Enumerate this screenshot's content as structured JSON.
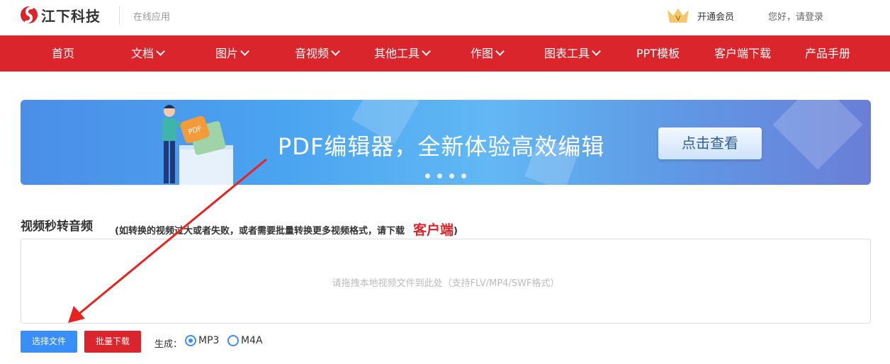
{
  "header": {
    "brand": "江下科技",
    "tagline": "在线应用",
    "vip_label": "开通会员",
    "login_label": "您好，请登录"
  },
  "nav": {
    "items": [
      {
        "label": "首页",
        "dropdown": false
      },
      {
        "label": "文档",
        "dropdown": true
      },
      {
        "label": "图片",
        "dropdown": true
      },
      {
        "label": "音视频",
        "dropdown": true
      },
      {
        "label": "其他工具",
        "dropdown": true
      },
      {
        "label": "作图",
        "dropdown": true
      },
      {
        "label": "图表工具",
        "dropdown": true
      },
      {
        "label": "PPT模板",
        "dropdown": false
      },
      {
        "label": "客户端下载",
        "dropdown": false
      },
      {
        "label": "产品手册",
        "dropdown": false
      }
    ]
  },
  "banner": {
    "headline": "PDF编辑器，全新体验高效编辑",
    "button_label": "点击查看",
    "badge_text": "PDF",
    "slides": 4
  },
  "tool": {
    "title": "视频秒转音频",
    "note_prefix": "(如转换的视频过大或者失败，或者需要批量转换更多视频格式，请下载",
    "client_link": "客户端",
    "note_suffix": ")",
    "drop_hint": "请拖拽本地视频文件到此处（支持FLV/MP4/SWF格式）",
    "choose_label": "选择文件",
    "batch_label": "批量下载",
    "generate_label": "生成：",
    "formats": [
      {
        "label": "MP3",
        "checked": true
      },
      {
        "label": "M4A",
        "checked": false
      }
    ]
  },
  "colors": {
    "brand_red": "#d9252b",
    "accent_blue": "#3a8ef8"
  }
}
